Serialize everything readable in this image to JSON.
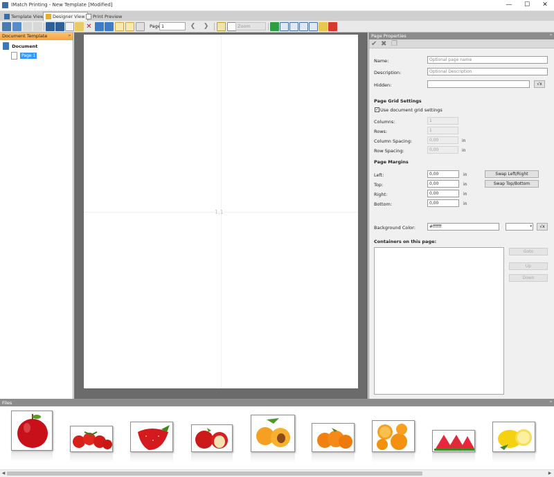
{
  "window": {
    "title": "IMatch Printing - New Template [Modified]",
    "min_glyph": "—",
    "max_glyph": "☐",
    "close_glyph": "✕"
  },
  "tabs": [
    {
      "label": "Template View"
    },
    {
      "label": "Designer View"
    },
    {
      "label": "Print Preview"
    }
  ],
  "toolbar": {
    "page_label": "Page",
    "page_value": "1",
    "zoom_value": "Zoom"
  },
  "left_panel": {
    "title": "Document Template",
    "pin": "ᵖ",
    "root_label": "Document",
    "page_label": "Page 1"
  },
  "canvas": {
    "cell_label": "1,1"
  },
  "page_properties": {
    "title": "Page Properties",
    "pin": "ᵖ",
    "name_label": "Name:",
    "name_placeholder": "Optional page name",
    "description_label": "Description:",
    "description_placeholder": "Optional Description",
    "hidden_label": "Hidden:",
    "fx_label": "√x",
    "grid_section": "Page Grid Settings",
    "use_grid_label": "Use document grid settings",
    "use_grid_checked": true,
    "columns_label": "Columns:",
    "columns_value": "1",
    "rows_label": "Rows:",
    "rows_value": "1",
    "col_spacing_label": "Column Spacing:",
    "col_spacing_value": "0,00",
    "row_spacing_label": "Row Spacing:",
    "row_spacing_value": "0,00",
    "unit": "in",
    "margins_section": "Page Margins",
    "left_label": "Left:",
    "left_value": "0,00",
    "top_label": "Top:",
    "top_value": "0,00",
    "right_label": "Right:",
    "right_value": "0,00",
    "bottom_label": "Bottom:",
    "bottom_value": "0,00",
    "swap_lr": "Swap Left/Right",
    "swap_tb": "Swap Top/Bottom",
    "bg_label": "Background Color:",
    "bg_value": "#ffffff",
    "containers_section": "Containers on this page:",
    "goto_btn": "Goto",
    "up_btn": "Up",
    "down_btn": "Down"
  },
  "files": {
    "title": "Files",
    "pin": "ᵖ",
    "items": [
      {
        "name": "apple"
      },
      {
        "name": "tomatoes"
      },
      {
        "name": "strawberry"
      },
      {
        "name": "apples"
      },
      {
        "name": "apricots"
      },
      {
        "name": "oranges"
      },
      {
        "name": "orange-slices"
      },
      {
        "name": "watermelon"
      },
      {
        "name": "lemons"
      }
    ]
  },
  "colors": {
    "accent_orange": "#f5a23d",
    "selection_blue": "#3399ff",
    "canvas_grey": "#6b6b6b"
  }
}
